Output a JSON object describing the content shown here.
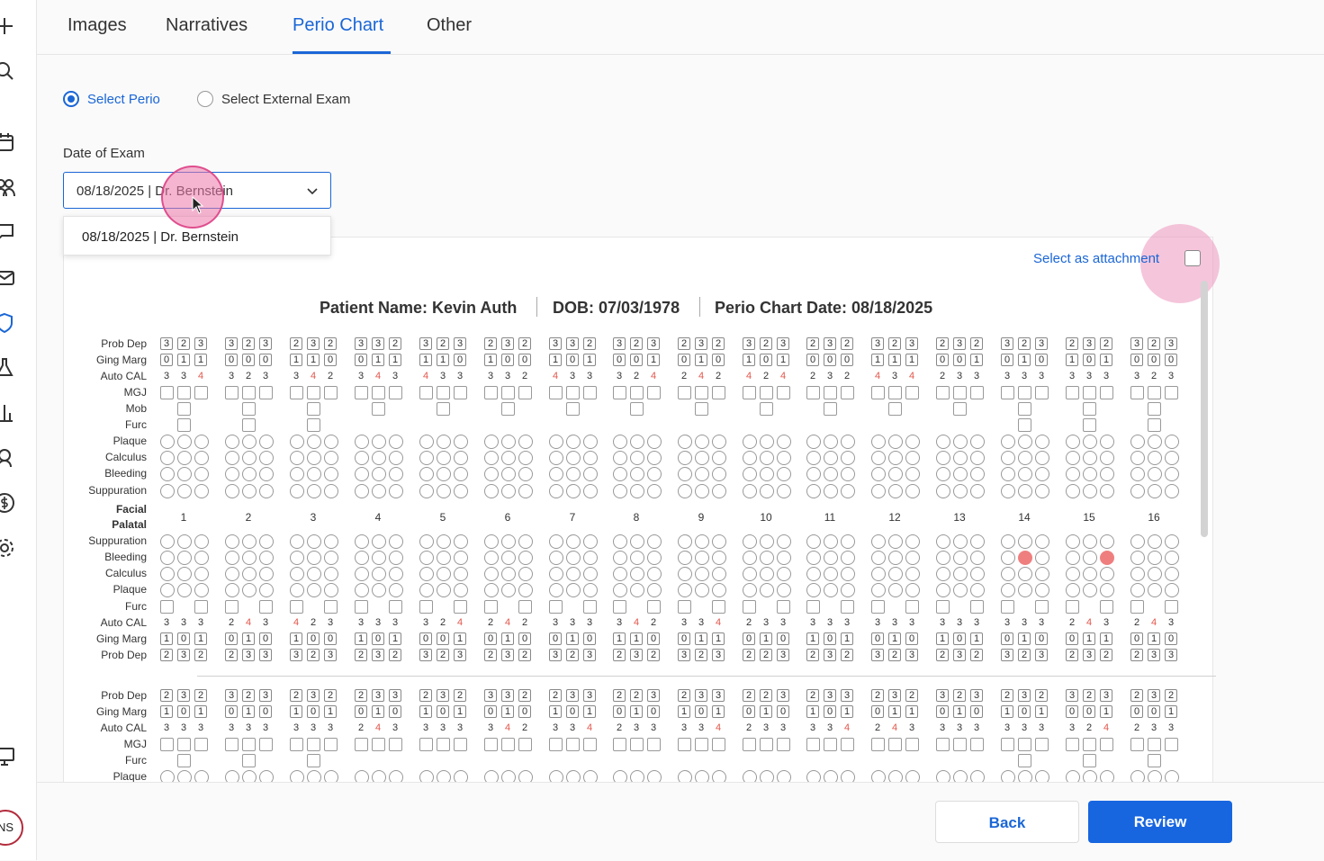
{
  "sidebar": {
    "icons": [
      "plus-icon",
      "search-icon",
      "calendar-icon",
      "people-icon",
      "chat-icon",
      "mail-icon",
      "shield-icon",
      "flask-icon",
      "chart-icon",
      "person-icon",
      "dollar-icon",
      "gear-icon",
      "computer-icon"
    ],
    "avatar_initials": "NS"
  },
  "tabs": [
    {
      "label": "Images"
    },
    {
      "label": "Narratives"
    },
    {
      "label": "Perio Chart",
      "active": true
    },
    {
      "label": "Other"
    }
  ],
  "radios": {
    "perio_label": "Select Perio",
    "external_label": "Select External Exam",
    "selected": "perio"
  },
  "date_of_exam": {
    "label": "Date of Exam",
    "value": "08/18/2025 | Dr. Bernstein",
    "options": [
      "08/18/2025 | Dr. Bernstein"
    ]
  },
  "attachment": {
    "label": "Select as attachment",
    "checked": false
  },
  "chart_header": {
    "patient": "Patient Name: Kevin Auth",
    "dob": "DOB: 07/03/1978",
    "chart_date": "Perio Chart Date: 08/18/2025"
  },
  "labels": {
    "upper_facial": [
      "Prob Dep",
      "Ging Marg",
      "Auto CAL",
      "MGJ",
      "Mob",
      "Furc",
      "Plaque",
      "Calculus",
      "Bleeding",
      "Suppuration"
    ],
    "facial": "Facial",
    "palatal": "Palatal",
    "upper_palatal": [
      "Suppuration",
      "Bleeding",
      "Calculus",
      "Plaque",
      "Furc",
      "Auto CAL",
      "Ging Marg",
      "Prob Dep"
    ],
    "lower_facial": [
      "Prob Dep",
      "Ging Marg",
      "Auto CAL",
      "MGJ",
      "Furc",
      "Plaque"
    ]
  },
  "teeth": [
    "1",
    "2",
    "3",
    "4",
    "5",
    "6",
    "7",
    "8",
    "9",
    "10",
    "11",
    "12",
    "13",
    "14",
    "15",
    "16"
  ],
  "upper_facial": {
    "prob_dep": [
      "323",
      "323",
      "232",
      "332",
      "323",
      "232",
      "332",
      "323",
      "232",
      "323",
      "232",
      "323",
      "232",
      "323",
      "232",
      "323"
    ],
    "ging_marg": [
      "011",
      "000",
      "110",
      "011",
      "110",
      "100",
      "101",
      "001",
      "010",
      "101",
      "000",
      "111",
      "001",
      "010",
      "101",
      "000"
    ],
    "auto_cal": [
      "334",
      "323",
      "342",
      "343",
      "433",
      "332",
      "433",
      "324",
      "242",
      "424",
      "232",
      "434",
      "233",
      "333",
      "333",
      "323"
    ]
  },
  "upper_palatal": {
    "auto_cal": [
      "333",
      "243",
      "423",
      "333",
      "324",
      "242",
      "333",
      "342",
      "334",
      "233",
      "333",
      "333",
      "333",
      "333",
      "243",
      "243"
    ],
    "ging_marg": [
      "101",
      "010",
      "100",
      "101",
      "001",
      "010",
      "010",
      "110",
      "011",
      "010",
      "101",
      "010",
      "101",
      "010",
      "011",
      "010"
    ],
    "prob_dep": [
      "232",
      "233",
      "323",
      "232",
      "323",
      "232",
      "323",
      "232",
      "323",
      "223",
      "232",
      "323",
      "232",
      "323",
      "232",
      "233"
    ],
    "bleeding_marked": {
      "14": 1,
      "15": 2
    }
  },
  "lower_facial": {
    "prob_dep": [
      "232",
      "323",
      "232",
      "233",
      "232",
      "332",
      "233",
      "223",
      "233",
      "223",
      "233",
      "232",
      "323",
      "232",
      "323",
      "232"
    ],
    "ging_marg": [
      "101",
      "010",
      "101",
      "010",
      "101",
      "010",
      "101",
      "010",
      "101",
      "010",
      "101",
      "011",
      "010",
      "101",
      "001",
      "001"
    ],
    "auto_cal": [
      "333",
      "333",
      "333",
      "243",
      "333",
      "342",
      "334",
      "233",
      "334",
      "233",
      "334",
      "243",
      "333",
      "333",
      "324",
      "233"
    ]
  },
  "footer": {
    "back_label": "Back",
    "review_label": "Review"
  }
}
